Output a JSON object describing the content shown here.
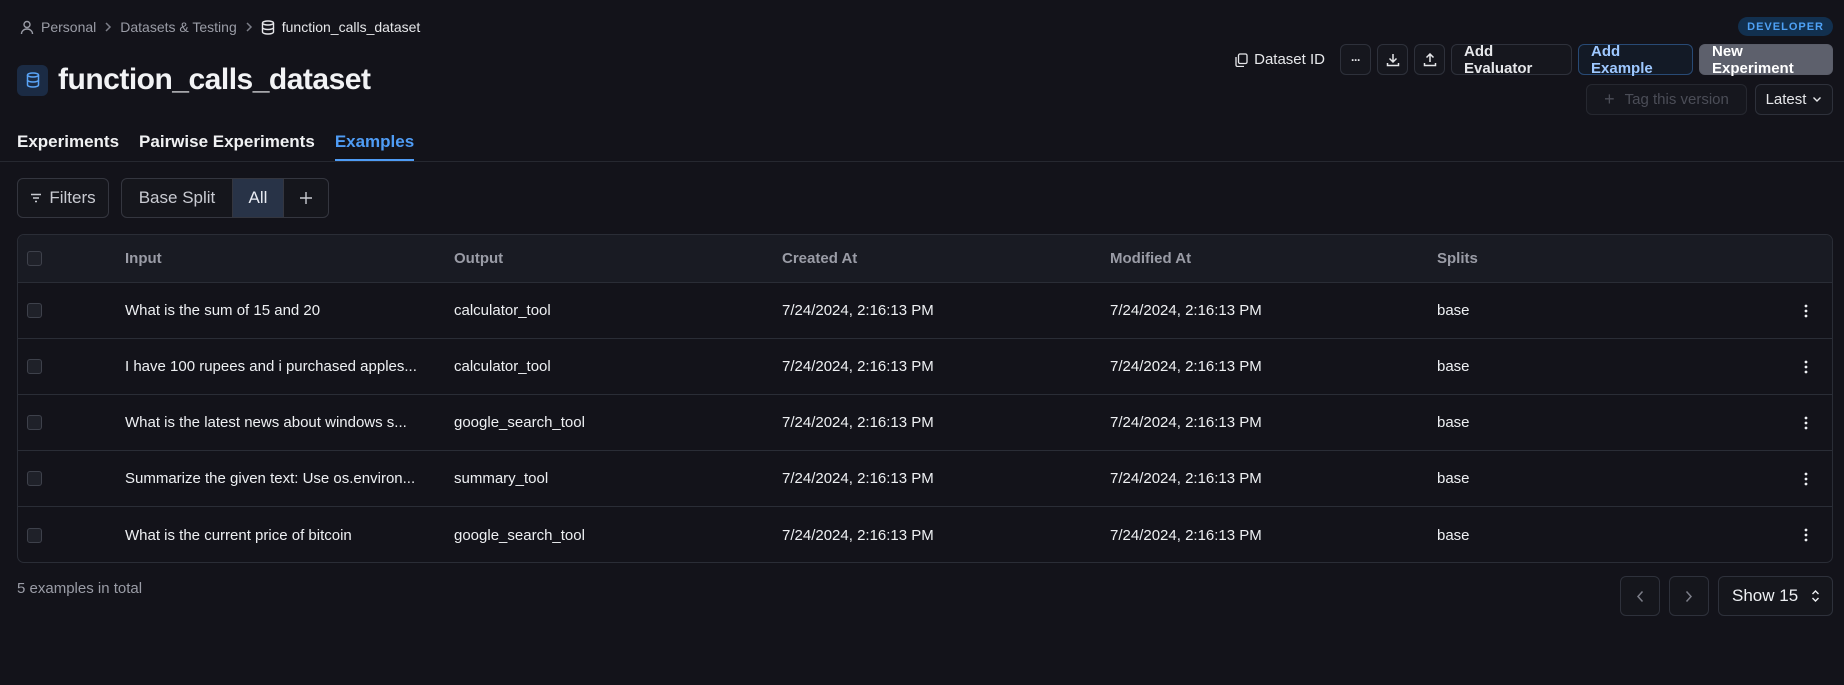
{
  "breadcrumb": {
    "items": [
      "Personal",
      "Datasets & Testing",
      "function_calls_dataset"
    ]
  },
  "badge": "DEVELOPER",
  "page_title": "function_calls_dataset",
  "toolbar": {
    "dataset_id_label": "Dataset ID",
    "more_label": "···",
    "add_evaluator_label": "Add Evaluator",
    "add_example_label": "Add Example",
    "new_experiment_label": "New Experiment",
    "tag_version_label": "Tag this version",
    "version_label": "Latest"
  },
  "tabs": [
    {
      "label": "Experiments",
      "active": false
    },
    {
      "label": "Pairwise Experiments",
      "active": false
    },
    {
      "label": "Examples",
      "active": true
    }
  ],
  "filters": {
    "filters_label": "Filters",
    "splits": [
      "Base Split",
      "All"
    ],
    "add_label": "+"
  },
  "table": {
    "columns": [
      "Input",
      "Output",
      "Created At",
      "Modified At",
      "Splits"
    ],
    "rows": [
      {
        "input": "What is the sum of 15 and 20",
        "output": "calculator_tool",
        "created": "7/24/2024, 2:16:13 PM",
        "modified": "7/24/2024, 2:16:13 PM",
        "splits": "base"
      },
      {
        "input": "I have 100 rupees and i purchased apples...",
        "output": "calculator_tool",
        "created": "7/24/2024, 2:16:13 PM",
        "modified": "7/24/2024, 2:16:13 PM",
        "splits": "base"
      },
      {
        "input": "What is the latest news about windows s...",
        "output": "google_search_tool",
        "created": "7/24/2024, 2:16:13 PM",
        "modified": "7/24/2024, 2:16:13 PM",
        "splits": "base"
      },
      {
        "input": "Summarize the given text: Use os.environ...",
        "output": "summary_tool",
        "created": "7/24/2024, 2:16:13 PM",
        "modified": "7/24/2024, 2:16:13 PM",
        "splits": "base"
      },
      {
        "input": "What is the current price of bitcoin",
        "output": "google_search_tool",
        "created": "7/24/2024, 2:16:13 PM",
        "modified": "7/24/2024, 2:16:13 PM",
        "splits": "base"
      }
    ]
  },
  "footer": {
    "total_text": "5 examples in total",
    "page_size_label": "Show 15"
  },
  "icons": {
    "person": "person-icon",
    "chevron": "chevron-right-icon",
    "database": "database-icon",
    "copy": "copy-icon",
    "download": "download-icon",
    "upload": "upload-icon",
    "filter": "filter-icon",
    "kebab": "kebab-menu-icon"
  },
  "colors": {
    "background": "#13131a",
    "accent": "#4f9cf5",
    "primary_button": "#5d606c"
  }
}
